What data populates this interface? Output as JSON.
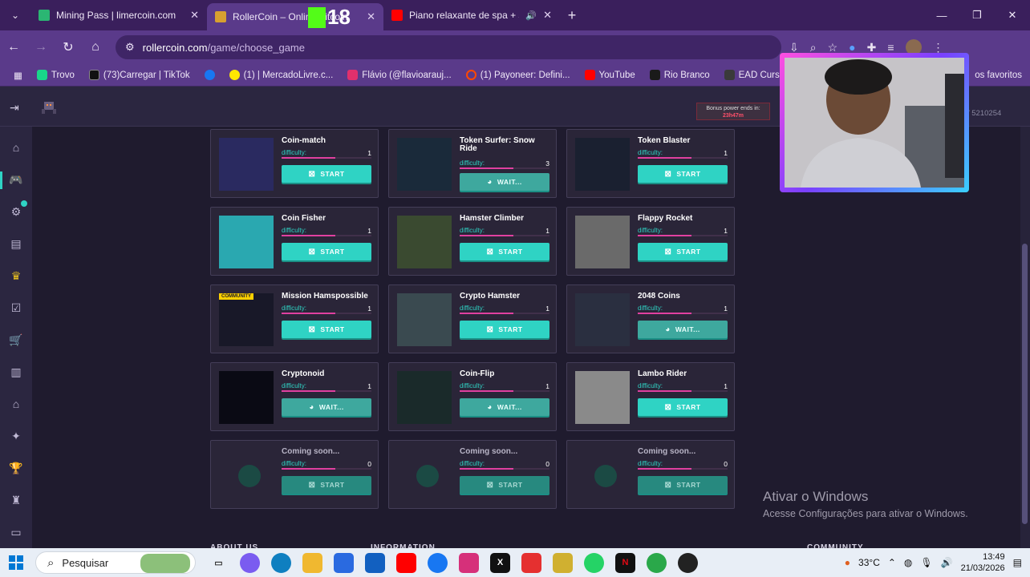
{
  "browser": {
    "tabs": [
      {
        "title": "Mining Pass | limercoin.com",
        "favicon_color": "#2bb673",
        "active": false
      },
      {
        "title": "RollerCoin – Online Bitcoin",
        "favicon_color": "#d8a030",
        "active": true
      },
      {
        "title": "Piano relaxante de spa + sons",
        "favicon_color": "#ff0000",
        "active": false
      }
    ],
    "tab_close": "✕",
    "new_tab": "+",
    "overlay_badge": "18",
    "url_host": "rollercoin.com",
    "url_path": "/game/choose_game",
    "bookmarks": [
      {
        "label": "Trovo",
        "color": "#19d68a"
      },
      {
        "label": "(73)Carregar | TikTok",
        "color": "#111111"
      },
      {
        "label": "",
        "color": "#1877f2"
      },
      {
        "label": "(1) | MercadoLivre.c...",
        "color": "#ffe600"
      },
      {
        "label": "Flávio (@flavioarauj...",
        "color": "#e1306c"
      },
      {
        "label": "(1) Payoneer: Defini...",
        "color": "#ff4800"
      },
      {
        "label": "YouTube",
        "color": "#ff0000"
      },
      {
        "label": "Rio Branco",
        "color": "#222222"
      },
      {
        "label": "EAD Cursos",
        "color": "#444444"
      }
    ],
    "bookmarks_right": "os favoritos"
  },
  "site": {
    "bonus_line1": "Bonus power ends in:",
    "bonus_line2": "23h47m",
    "hashrate": "/ 5210254"
  },
  "games": [
    {
      "name": "Coin-match",
      "difficulty": "1",
      "button": "START",
      "state": "start"
    },
    {
      "name": "Token Surfer: Snow Ride",
      "difficulty": "3",
      "button": "WAIT...",
      "state": "wait"
    },
    {
      "name": "Token Blaster",
      "difficulty": "1",
      "button": "START",
      "state": "start"
    },
    {
      "name": "Coin Fisher",
      "difficulty": "1",
      "button": "START",
      "state": "start"
    },
    {
      "name": "Hamster Climber",
      "difficulty": "1",
      "button": "START",
      "state": "start"
    },
    {
      "name": "Flappy Rocket",
      "difficulty": "1",
      "button": "START",
      "state": "start"
    },
    {
      "name": "Mission Hamspossible",
      "difficulty": "1",
      "button": "START",
      "state": "start",
      "badge": "COMMUNITY"
    },
    {
      "name": "Crypto Hamster",
      "difficulty": "1",
      "button": "START",
      "state": "start"
    },
    {
      "name": "2048 Coins",
      "difficulty": "1",
      "button": "WAIT...",
      "state": "wait"
    },
    {
      "name": "Cryptonoid",
      "difficulty": "1",
      "button": "WAIT...",
      "state": "wait"
    },
    {
      "name": "Coin-Flip",
      "difficulty": "1",
      "button": "WAIT...",
      "state": "wait"
    },
    {
      "name": "Lambo Rider",
      "difficulty": "1",
      "button": "START",
      "state": "start"
    },
    {
      "name": "Coming soon...",
      "difficulty": "0",
      "button": "START",
      "state": "soon"
    },
    {
      "name": "Coming soon...",
      "difficulty": "0",
      "button": "START",
      "state": "soon"
    },
    {
      "name": "Coming soon...",
      "difficulty": "0",
      "button": "START",
      "state": "soon"
    }
  ],
  "difficulty_label": "difficulty:",
  "footer_peek": [
    "ABOUT US",
    "INFORMATION",
    "COMMUNITY"
  ],
  "watermark": {
    "title": "Ativar o Windows",
    "subtitle": "Acesse Configurações para ativar o Windows."
  },
  "taskbar": {
    "search_label": "Pesquisar",
    "temperature": "33°C",
    "time": "13:49",
    "date": "21/03/2026"
  }
}
